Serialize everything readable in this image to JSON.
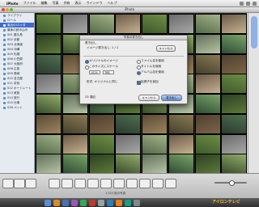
{
  "menubar": {
    "apple": "",
    "items": [
      "iPhoto",
      "ファイル",
      "編集",
      "写真",
      "共有",
      "表示",
      "ウインドウ",
      "ヘルプ"
    ]
  },
  "window": {
    "title": "iPhoto"
  },
  "sidebar": {
    "items": [
      {
        "label": "ライブラリ"
      },
      {
        "label": "ロール"
      },
      {
        "label": "最近の12ヶ月"
      },
      {
        "label": "最後の読み込み"
      },
      {
        "label": "001 屋久島"
      },
      {
        "label": "002 京都"
      },
      {
        "label": "003 北海道"
      },
      {
        "label": "004 沖縄"
      },
      {
        "label": "005 札幌"
      },
      {
        "label": "006 小笠原"
      },
      {
        "label": "007 大阪府"
      },
      {
        "label": "008 広島"
      },
      {
        "label": "009 長崎"
      },
      {
        "label": "010 名古屋"
      },
      {
        "label": "011 奈良"
      },
      {
        "label": "012 ポートレート"
      },
      {
        "label": "013 家族"
      },
      {
        "label": "014 旅行"
      },
      {
        "label": "015 仕事"
      },
      {
        "label": "016 ペット"
      }
    ]
  },
  "dialog": {
    "title": "写真の書き出し",
    "tab_label": "書き出し",
    "count_label": "イメージ書き出し: 1 / 1",
    "cancel_top": "キャンセル",
    "option1": "オリジナルのイメージ",
    "option2": "このサイズにスケール",
    "width_value": "1024",
    "height_value": "768",
    "option3": "ファイル名を使用",
    "option4": "タイトルを使用",
    "option5": "アルバム名を使用",
    "extension_label": "拡張子を追加",
    "format_label": "形式: オリジナルと同じ",
    "item_count": "23 項目",
    "cancel_button": "キャンセル",
    "export_button": "書き出し"
  },
  "bottombar": {
    "info_text": "1,323 枚の写真"
  },
  "dock": {
    "overlay_text": "アイロンテレビ"
  },
  "colors": {
    "accent": "#3d6ccf",
    "dock_text": "#f0c23a"
  }
}
